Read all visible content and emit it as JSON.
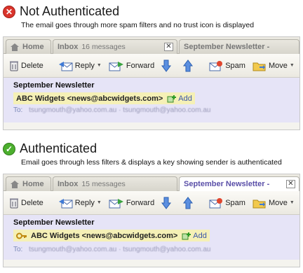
{
  "not_authenticated": {
    "title": "Not Authenticated",
    "caption": "The email goes through more spam filters and no trust icon is displayed",
    "tabs": {
      "home": "Home",
      "inbox": "Inbox",
      "inbox_count": "16 messages",
      "newsletter": "September Newsletter -"
    },
    "toolbar": {
      "delete": "Delete",
      "reply": "Reply",
      "forward": "Forward",
      "spam": "Spam",
      "move": "Move"
    },
    "message": {
      "subject": "September Newsletter",
      "from": "ABC Widgets <news@abcwidgets.com>",
      "add": "Add",
      "to_label": "To:",
      "to_value": "tsungmouth@yahoo.com.au · tsungmouth@yahoo.com.au"
    }
  },
  "authenticated": {
    "title": "Authenticated",
    "caption": "Email goes through less filters & displays a key showing sender is authenticated",
    "tabs": {
      "home": "Home",
      "inbox": "Inbox",
      "inbox_count": "15 messages",
      "newsletter": "September Newsletter -"
    },
    "toolbar": {
      "delete": "Delete",
      "reply": "Reply",
      "forward": "Forward",
      "spam": "Spam",
      "move": "Move"
    },
    "message": {
      "subject": "September Newsletter",
      "from": "ABC Widgets <news@abcwidgets.com>",
      "add": "Add",
      "to_label": "To:",
      "to_value": "tsungmouth@yahoo.com.au · tsungmouth@yahoo.com.au"
    }
  },
  "icons": {
    "error": "error-x-icon",
    "success": "check-icon",
    "home": "home-icon",
    "delete": "trash-icon",
    "reply": "reply-envelope-icon",
    "forward": "forward-envelope-icon",
    "down": "arrow-down-icon",
    "up": "arrow-up-icon",
    "spam": "spam-icon",
    "move": "folder-move-icon",
    "add": "add-contact-icon",
    "key": "key-icon"
  },
  "colors": {
    "error": "#d9342b",
    "success": "#4caf2e",
    "active_tab_text": "#5a4fa8",
    "message_header_bg": "#e6e4f7",
    "from_highlight": "#f5f0b6"
  }
}
